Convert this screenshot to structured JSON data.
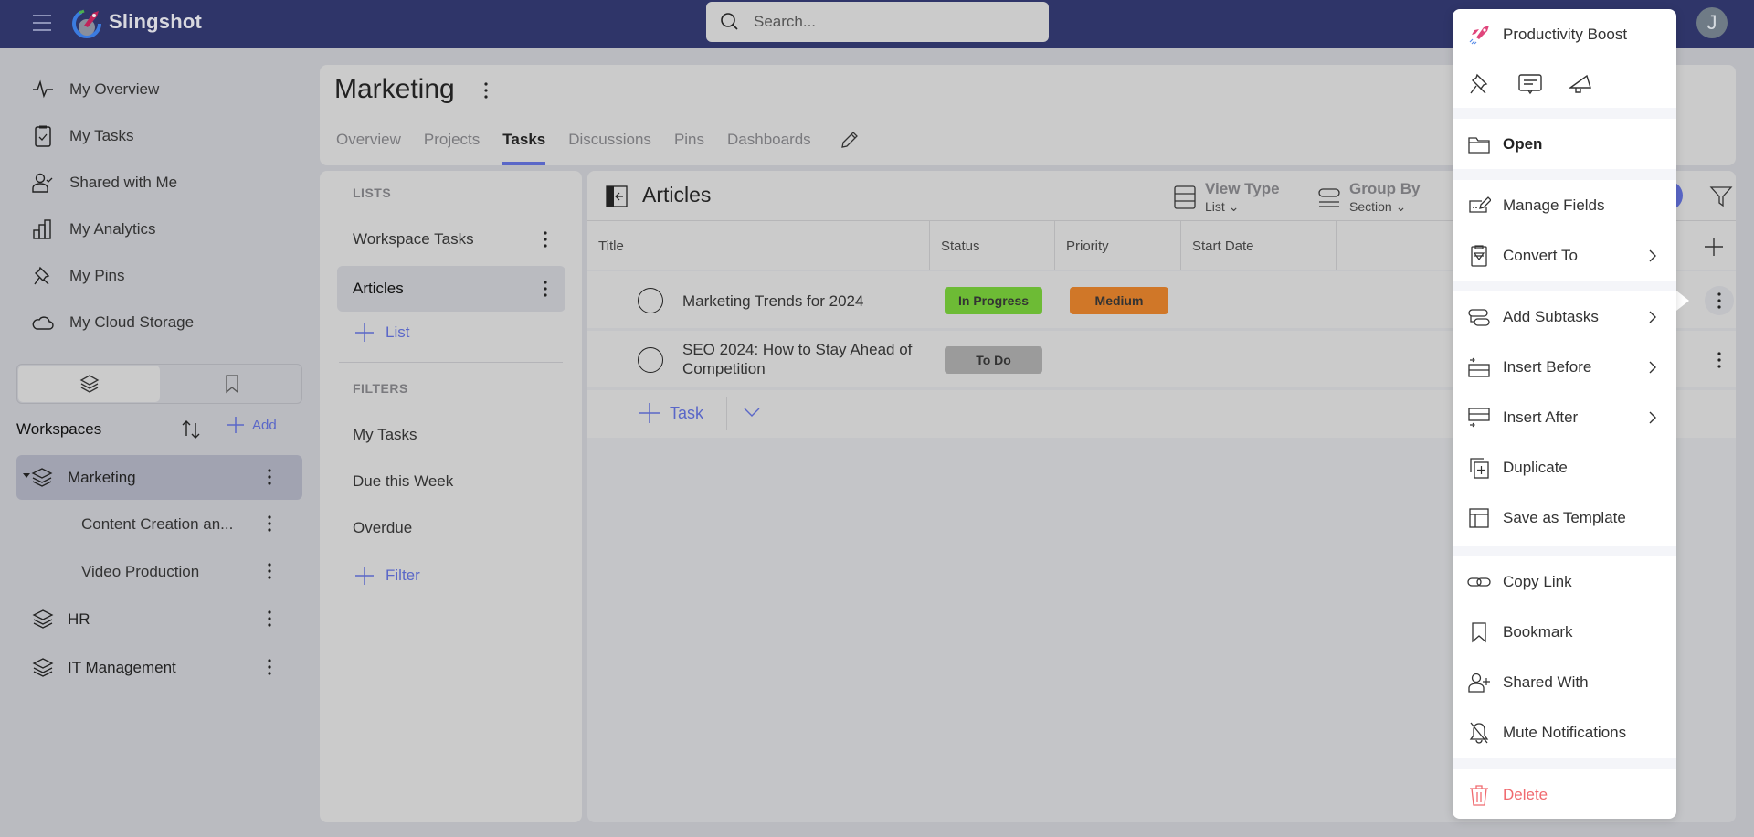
{
  "app": {
    "brand": "Slingshot",
    "search_placeholder": "Search...",
    "avatar_initial": "J"
  },
  "sidebar": {
    "nav": [
      {
        "label": "My Overview",
        "icon": "activity-icon"
      },
      {
        "label": "My Tasks",
        "icon": "clipboard-check-icon"
      },
      {
        "label": "Shared with Me",
        "icon": "user-check-icon"
      },
      {
        "label": "My Analytics",
        "icon": "bar-chart-icon"
      },
      {
        "label": "My Pins",
        "icon": "pin-icon"
      },
      {
        "label": "My Cloud Storage",
        "icon": "cloud-icon"
      }
    ],
    "workspaces_title": "Workspaces",
    "add_label": "Add",
    "workspaces": [
      {
        "label": "Marketing",
        "active": true,
        "expanded": true
      },
      {
        "label": "Content Creation an...",
        "child": true
      },
      {
        "label": "Video Production",
        "child": true
      },
      {
        "label": "HR"
      },
      {
        "label": "IT Management"
      }
    ]
  },
  "header": {
    "title": "Marketing",
    "tabs": [
      {
        "label": "Overview"
      },
      {
        "label": "Projects"
      },
      {
        "label": "Tasks",
        "active": true
      },
      {
        "label": "Discussions"
      },
      {
        "label": "Pins"
      },
      {
        "label": "Dashboards"
      }
    ]
  },
  "lists_panel": {
    "lists_heading": "LISTS",
    "lists": [
      {
        "label": "Workspace Tasks"
      },
      {
        "label": "Articles",
        "active": true
      }
    ],
    "add_list_label": "List",
    "filters_heading": "FILTERS",
    "filters": [
      {
        "label": "My Tasks"
      },
      {
        "label": "Due this Week"
      },
      {
        "label": "Overdue"
      }
    ],
    "add_filter_label": "Filter"
  },
  "main": {
    "list_title": "Articles",
    "view_type": {
      "label": "View Type",
      "value": "List"
    },
    "group_by": {
      "label": "Group By",
      "value": "Section"
    },
    "columns": [
      "Title",
      "Status",
      "Priority",
      "Start Date"
    ],
    "tasks": [
      {
        "title": "Marketing Trends for 2024",
        "status": "In Progress",
        "status_color": "#6dbb35",
        "priority": "Medium",
        "priority_color": "#d07728"
      },
      {
        "title": "SEO 2024: How to Stay Ahead of Competition",
        "status": "To Do",
        "status_color": "#9b9b9b",
        "priority": "",
        "priority_color": ""
      }
    ],
    "add_task_label": "Task"
  },
  "context_menu": {
    "header_item": "Productivity Boost",
    "quick_icons": [
      "pin-icon",
      "comment-icon",
      "megaphone-icon"
    ],
    "items": [
      {
        "label": "Open",
        "icon": "folder-icon",
        "bold": true
      },
      {
        "label": "Manage Fields",
        "icon": "edit-fields-icon"
      },
      {
        "label": "Convert To",
        "icon": "convert-icon",
        "submenu": true
      },
      {
        "label": "Add Subtasks",
        "icon": "subtasks-icon",
        "submenu": true
      },
      {
        "label": "Insert Before",
        "icon": "insert-before-icon",
        "submenu": true
      },
      {
        "label": "Insert After",
        "icon": "insert-after-icon",
        "submenu": true
      },
      {
        "label": "Duplicate",
        "icon": "duplicate-icon"
      },
      {
        "label": "Save as Template",
        "icon": "template-icon"
      },
      {
        "label": "Copy Link",
        "icon": "link-icon"
      },
      {
        "label": "Bookmark",
        "icon": "bookmark-icon"
      },
      {
        "label": "Shared With",
        "icon": "user-add-icon"
      },
      {
        "label": "Mute Notifications",
        "icon": "bell-off-icon"
      },
      {
        "label": "Delete",
        "icon": "trash-icon",
        "danger": true
      }
    ]
  },
  "colors": {
    "topbar": "#2f3569",
    "accent": "#5a67c8",
    "danger": "#f06a6f"
  }
}
